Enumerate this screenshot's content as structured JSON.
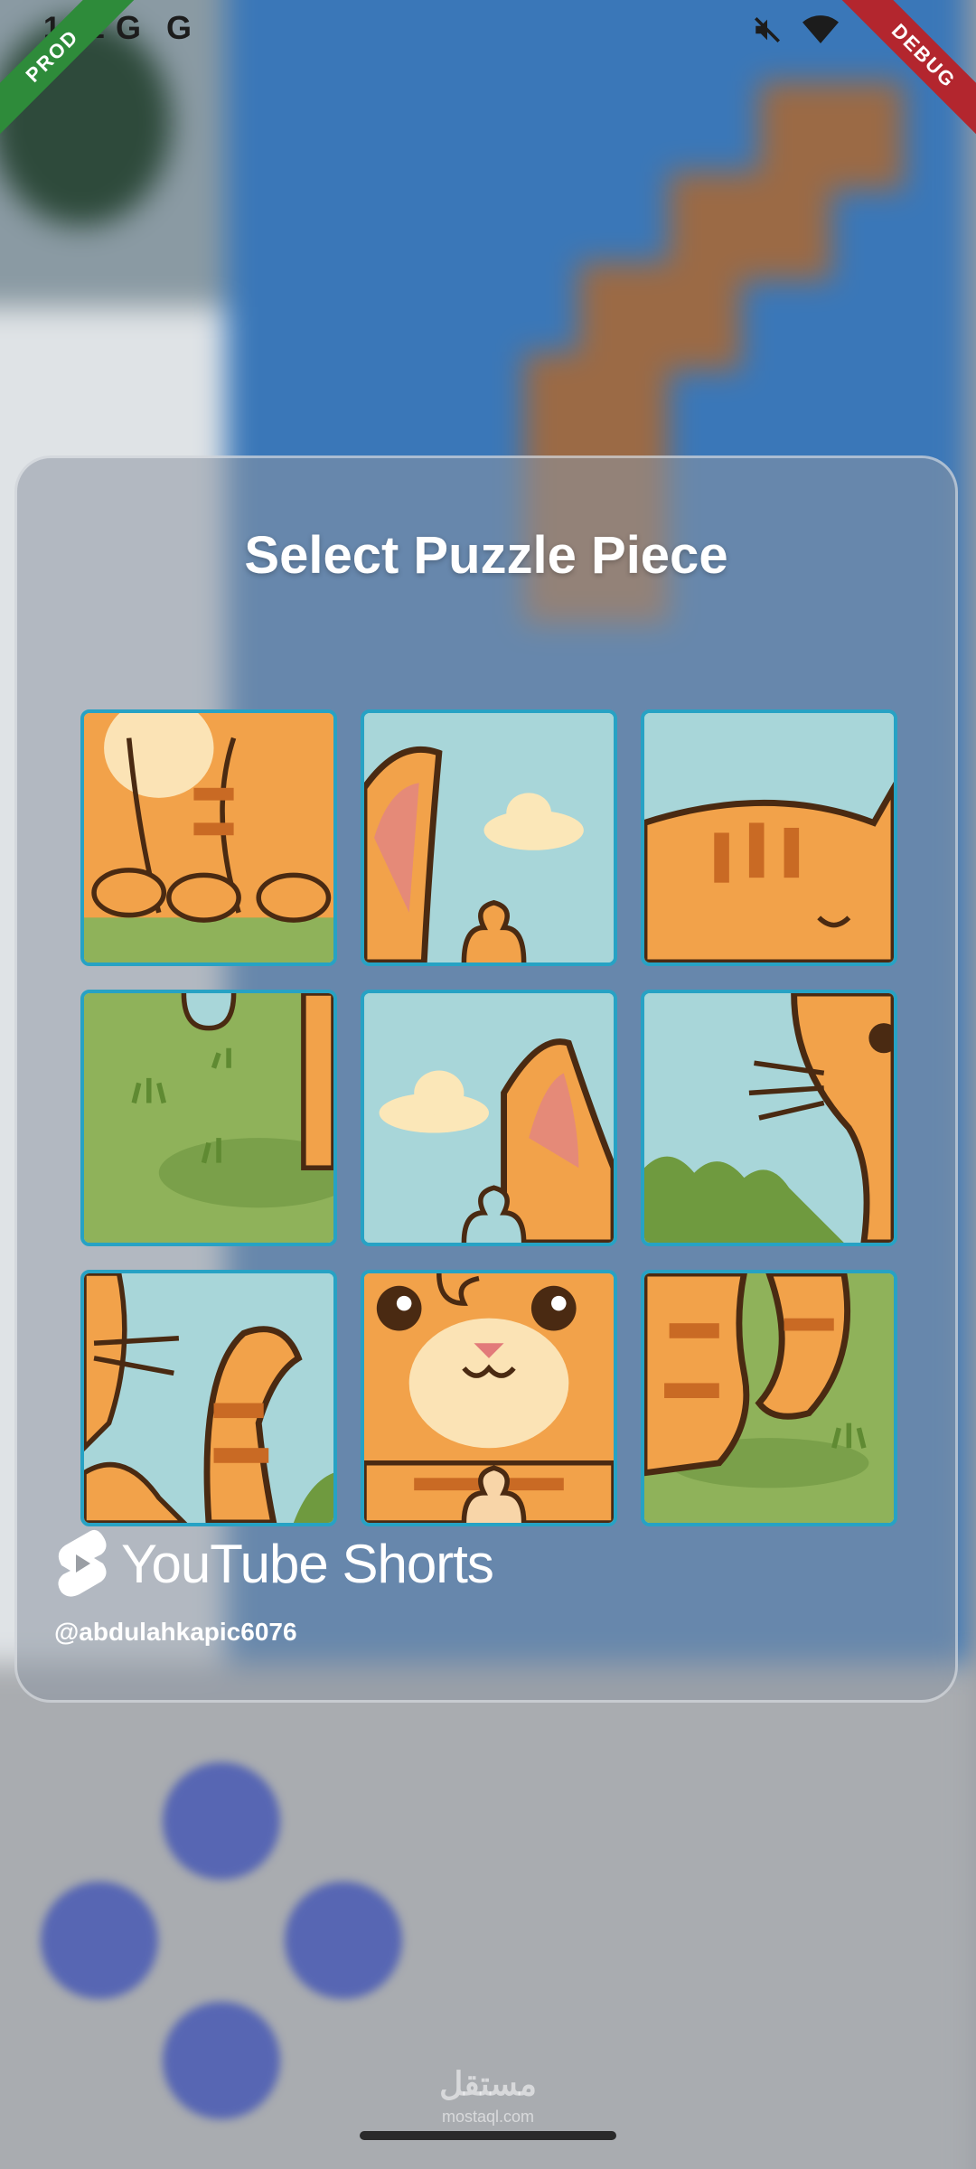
{
  "status_bar": {
    "time": "1:22",
    "icons": [
      "google-icon",
      "google-icon",
      "mute-icon",
      "wifi-icon",
      "battery-icon"
    ]
  },
  "ribbons": {
    "left": "PROD",
    "right": "DEBUG"
  },
  "modal": {
    "title": "Select Puzzle Piece",
    "pieces": [
      {
        "row": 1,
        "col": 1,
        "content": "cat paws on grass"
      },
      {
        "row": 1,
        "col": 2,
        "content": "cat ear with cloud"
      },
      {
        "row": 1,
        "col": 3,
        "content": "cat back with stripes"
      },
      {
        "row": 2,
        "col": 1,
        "content": "grass"
      },
      {
        "row": 2,
        "col": 2,
        "content": "cloud and cat ear"
      },
      {
        "row": 2,
        "col": 3,
        "content": "cat whiskers and bush"
      },
      {
        "row": 3,
        "col": 1,
        "content": "cat tail and whiskers"
      },
      {
        "row": 3,
        "col": 2,
        "content": "cat face"
      },
      {
        "row": 3,
        "col": 3,
        "content": "cat tail on grass"
      }
    ]
  },
  "watermark": {
    "brand": "YouTube Shorts",
    "handle": "@abdulahkapic6076"
  },
  "footer": {
    "logo_arabic": "مستقل",
    "logo_latin": "mostaql.com"
  },
  "colors": {
    "piece_border": "#27a2c4",
    "sky": "#a8d6d9",
    "grass": "#8fb25a",
    "cat_orange": "#f2a24a",
    "outline": "#4a2a12"
  }
}
